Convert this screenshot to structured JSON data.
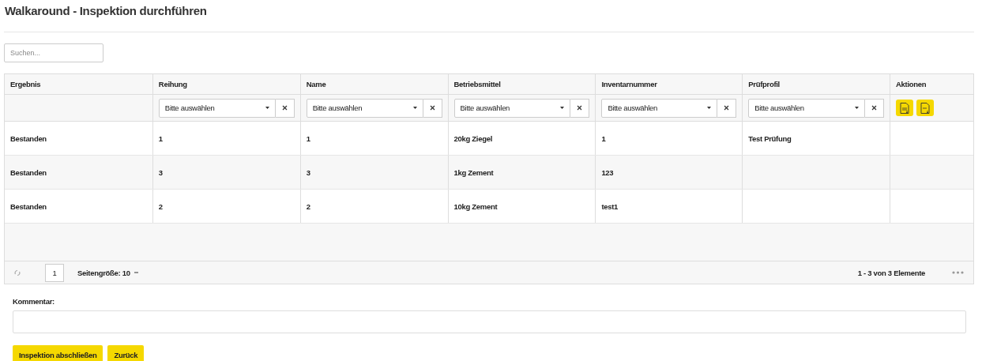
{
  "title": "Walkaround - Inspektion durchführen",
  "search": {
    "placeholder": "Suchen..."
  },
  "table": {
    "columns": [
      {
        "label": "Ergebnis",
        "kind": "plain"
      },
      {
        "label": "Reihung",
        "kind": "select",
        "filter": "Bitte auswählen"
      },
      {
        "label": "Name",
        "kind": "select",
        "filter": "Bitte auswählen"
      },
      {
        "label": "Betriebsmittel",
        "kind": "select",
        "filter": "Bitte auswählen"
      },
      {
        "label": "Inventarnummer",
        "kind": "select",
        "filter": "Bitte auswählen"
      },
      {
        "label": "Prüfprofil",
        "kind": "select",
        "filter": "Bitte auswählen"
      },
      {
        "label": "Aktionen",
        "kind": "actions"
      }
    ],
    "rows": [
      [
        "Bestanden",
        "1",
        "1",
        "20kg Ziegel",
        "1",
        "Test Prüfung",
        ""
      ],
      [
        "Bestanden",
        "3",
        "3",
        "1kg Zement",
        "123",
        "",
        ""
      ],
      [
        "Bestanden",
        "2",
        "2",
        "10kg Zement",
        "test1",
        "",
        ""
      ]
    ]
  },
  "pager": {
    "page": "1",
    "page_size": "Seitengröße: 10",
    "summary": "1 - 3 von 3 Elemente"
  },
  "comment": {
    "label": "Kommentar:"
  },
  "buttons": [
    "Inspektion abschließen",
    "Zurück"
  ]
}
